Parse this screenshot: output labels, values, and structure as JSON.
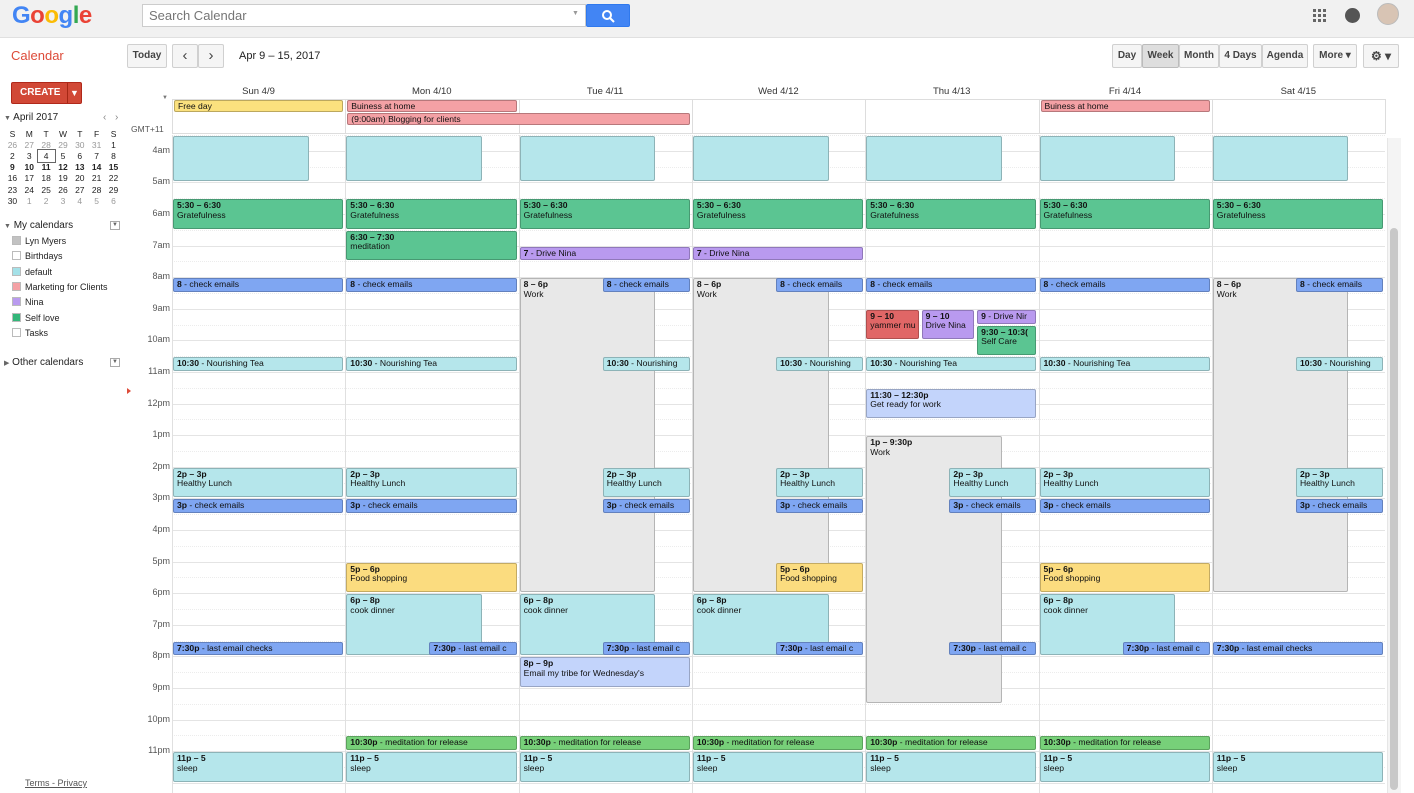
{
  "header": {
    "logo": "Google",
    "search_placeholder": "Search Calendar"
  },
  "toolbar": {
    "app_title": "Calendar",
    "today": "Today",
    "prev": "‹",
    "next": "›",
    "date_range": "Apr 9 – 15, 2017",
    "views": [
      "Day",
      "Week",
      "Month",
      "4 Days",
      "Agenda"
    ],
    "active_view": "Week",
    "more": "More ▾",
    "settings": "⚙ ▾"
  },
  "sidebar": {
    "create": "CREATE",
    "mini_month": "April 2017",
    "weekdays": [
      "S",
      "M",
      "T",
      "W",
      "T",
      "F",
      "S"
    ],
    "weeks": [
      [
        "26",
        "27",
        "28",
        "29",
        "30",
        "31",
        "1"
      ],
      [
        "2",
        "3",
        "4",
        "5",
        "6",
        "7",
        "8"
      ],
      [
        "9",
        "10",
        "11",
        "12",
        "13",
        "14",
        "15"
      ],
      [
        "16",
        "17",
        "18",
        "19",
        "20",
        "21",
        "22"
      ],
      [
        "23",
        "24",
        "25",
        "26",
        "27",
        "28",
        "29"
      ],
      [
        "30",
        "1",
        "2",
        "3",
        "4",
        "5",
        "6"
      ]
    ],
    "my_calendars": "My calendars",
    "calendars": [
      {
        "name": "Lyn Myers",
        "color": "#c2c2c2"
      },
      {
        "name": "Birthdays",
        "color": "#ffffff"
      },
      {
        "name": "default",
        "color": "#a4e1e8"
      },
      {
        "name": "Marketing for Clients",
        "color": "#f4a1a5"
      },
      {
        "name": "Nina",
        "color": "#b99aef"
      },
      {
        "name": "Self love",
        "color": "#33b679"
      },
      {
        "name": "Tasks",
        "color": "#ffffff"
      }
    ],
    "other_calendars": "Other calendars",
    "footer_terms": "Terms",
    "footer_sep": " - ",
    "footer_privacy": "Privacy"
  },
  "week": {
    "timezone": "GMT+11",
    "days": [
      "Sun 4/9",
      "Mon 4/10",
      "Tue 4/11",
      "Wed 4/12",
      "Thu 4/13",
      "Fri 4/14",
      "Sat 4/15"
    ],
    "hours": [
      "4am",
      "5am",
      "6am",
      "7am",
      "8am",
      "9am",
      "10am",
      "11am",
      "12pm",
      "1pm",
      "2pm",
      "3pm",
      "4pm",
      "5pm",
      "6pm",
      "7pm",
      "8pm",
      "9pm",
      "10pm",
      "11pm"
    ],
    "allday": [
      {
        "day": 0,
        "span": 1,
        "title": "Free day",
        "color": "#fbe17e"
      },
      {
        "day": 1,
        "span": 1,
        "title": "Buiness at home",
        "color": "#f4a1a5"
      },
      {
        "day": 1,
        "span": 2,
        "row": 1,
        "title": "(9:00am) Blogging for clients",
        "color": "#f4a1a5"
      },
      {
        "day": 5,
        "span": 1,
        "title": "Buiness at home",
        "color": "#f4a1a5"
      }
    ],
    "colors": {
      "default": "#b5e6eb",
      "selflove": "#5bc592",
      "emails": "#7fa6f2",
      "nina": "#b99aef",
      "work": "#e8e8e8",
      "food": "#fbdc7f",
      "lavender": "#c3d4fb",
      "meditation": "#77d079",
      "red": "#e06666"
    },
    "events": [
      {
        "day": 0,
        "start": 3.5,
        "end": 5.0,
        "c": "default",
        "t": "",
        "l": "",
        "w": 0.8
      },
      {
        "day": 1,
        "start": 3.5,
        "end": 5.0,
        "c": "default",
        "t": "",
        "l": "",
        "w": 0.8
      },
      {
        "day": 2,
        "start": 3.5,
        "end": 5.0,
        "c": "default",
        "t": "",
        "l": "",
        "w": 0.8
      },
      {
        "day": 3,
        "start": 3.5,
        "end": 5.0,
        "c": "default",
        "t": "",
        "l": "",
        "w": 0.8
      },
      {
        "day": 4,
        "start": 3.5,
        "end": 5.0,
        "c": "default",
        "t": "",
        "l": "",
        "w": 0.8
      },
      {
        "day": 5,
        "start": 3.5,
        "end": 5.0,
        "c": "default",
        "t": "",
        "l": "",
        "w": 0.8
      },
      {
        "day": 6,
        "start": 3.5,
        "end": 5.0,
        "c": "default",
        "t": "",
        "l": "",
        "w": 0.8
      },
      {
        "day": 0,
        "start": 5.5,
        "end": 6.5,
        "c": "selflove",
        "t": "5:30 – 6:30",
        "l": "Gratefulness"
      },
      {
        "day": 1,
        "start": 5.5,
        "end": 6.5,
        "c": "selflove",
        "t": "5:30 – 6:30",
        "l": "Gratefulness"
      },
      {
        "day": 2,
        "start": 5.5,
        "end": 6.5,
        "c": "selflove",
        "t": "5:30 – 6:30",
        "l": "Gratefulness"
      },
      {
        "day": 3,
        "start": 5.5,
        "end": 6.5,
        "c": "selflove",
        "t": "5:30 – 6:30",
        "l": "Gratefulness"
      },
      {
        "day": 4,
        "start": 5.5,
        "end": 6.5,
        "c": "selflove",
        "t": "5:30 – 6:30",
        "l": "Gratefulness"
      },
      {
        "day": 5,
        "start": 5.5,
        "end": 6.5,
        "c": "selflove",
        "t": "5:30 – 6:30",
        "l": "Gratefulness"
      },
      {
        "day": 6,
        "start": 5.5,
        "end": 6.5,
        "c": "selflove",
        "t": "5:30 – 6:30",
        "l": "Gratefulness"
      },
      {
        "day": 1,
        "start": 6.5,
        "end": 7.5,
        "c": "selflove",
        "t": "6:30 – 7:30",
        "l": "meditation"
      },
      {
        "day": 2,
        "start": 7,
        "end": 7.5,
        "c": "nina",
        "t": "7",
        "l": " - Drive Nina",
        "inline": true
      },
      {
        "day": 3,
        "start": 7,
        "end": 7.5,
        "c": "nina",
        "t": "7",
        "l": " - Drive Nina",
        "inline": true
      },
      {
        "day": 0,
        "start": 8,
        "end": 8.5,
        "c": "emails",
        "t": "8",
        "l": " - check emails",
        "inline": true
      },
      {
        "day": 1,
        "start": 8,
        "end": 8.5,
        "c": "emails",
        "t": "8",
        "l": " - check emails",
        "inline": true
      },
      {
        "day": 2,
        "start": 8,
        "end": 18,
        "c": "work",
        "t": "8 – 6p",
        "l": "Work",
        "w": 0.8
      },
      {
        "day": 2,
        "start": 8,
        "end": 8.5,
        "c": "emails",
        "t": "8",
        "l": " - check emails",
        "inline": true,
        "x": 0.48
      },
      {
        "day": 3,
        "start": 8,
        "end": 18,
        "c": "work",
        "t": "8 – 6p",
        "l": "Work",
        "w": 0.8
      },
      {
        "day": 3,
        "start": 8,
        "end": 8.5,
        "c": "emails",
        "t": "8",
        "l": " - check emails",
        "inline": true,
        "x": 0.48
      },
      {
        "day": 4,
        "start": 8,
        "end": 8.5,
        "c": "emails",
        "t": "8",
        "l": " - check emails",
        "inline": true
      },
      {
        "day": 5,
        "start": 8,
        "end": 8.5,
        "c": "emails",
        "t": "8",
        "l": " - check emails",
        "inline": true
      },
      {
        "day": 6,
        "start": 8,
        "end": 18,
        "c": "work",
        "t": "8 – 6p",
        "l": "Work",
        "w": 0.8
      },
      {
        "day": 6,
        "start": 8,
        "end": 8.5,
        "c": "emails",
        "t": "8",
        "l": " - check emails",
        "inline": true,
        "x": 0.48
      },
      {
        "day": 4,
        "start": 9,
        "end": 10,
        "c": "red",
        "t": "9 – 10",
        "l": "yammer mu",
        "w": 0.32
      },
      {
        "day": 4,
        "start": 9,
        "end": 10,
        "c": "nina",
        "t": "9 – 10",
        "l": "Drive Nina",
        "x": 0.32,
        "w": 0.32
      },
      {
        "day": 4,
        "start": 9,
        "end": 9.5,
        "c": "nina",
        "t": "9",
        "l": " - Drive Nir",
        "inline": true,
        "x": 0.64,
        "w": 0.36
      },
      {
        "day": 4,
        "start": 9.5,
        "end": 10.5,
        "c": "selflove",
        "t": "9:30 – 10:3(",
        "l": "Self Care",
        "x": 0.64,
        "w": 0.36
      },
      {
        "day": 0,
        "start": 10.5,
        "end": 11,
        "c": "default",
        "t": "10:30",
        "l": " - Nourishing Tea",
        "inline": true
      },
      {
        "day": 1,
        "start": 10.5,
        "end": 11,
        "c": "default",
        "t": "10:30",
        "l": " - Nourishing Tea",
        "inline": true
      },
      {
        "day": 2,
        "start": 10.5,
        "end": 11,
        "c": "default",
        "t": "10:30",
        "l": " - Nourishing",
        "inline": true,
        "x": 0.48
      },
      {
        "day": 3,
        "start": 10.5,
        "end": 11,
        "c": "default",
        "t": "10:30",
        "l": " - Nourishing",
        "inline": true,
        "x": 0.48
      },
      {
        "day": 4,
        "start": 10.5,
        "end": 11,
        "c": "default",
        "t": "10:30",
        "l": " - Nourishing Tea",
        "inline": true
      },
      {
        "day": 5,
        "start": 10.5,
        "end": 11,
        "c": "default",
        "t": "10:30",
        "l": " - Nourishing Tea",
        "inline": true
      },
      {
        "day": 6,
        "start": 10.5,
        "end": 11,
        "c": "default",
        "t": "10:30",
        "l": " - Nourishing",
        "inline": true,
        "x": 0.48
      },
      {
        "day": 4,
        "start": 11.5,
        "end": 12.5,
        "c": "lavender",
        "t": "11:30 – 12:30p",
        "l": "Get ready for work"
      },
      {
        "day": 4,
        "start": 13,
        "end": 21.5,
        "c": "work",
        "t": "1p – 9:30p",
        "l": "Work",
        "w": 0.8
      },
      {
        "day": 0,
        "start": 14,
        "end": 15,
        "c": "default",
        "t": "2p – 3p",
        "l": "Healthy Lunch"
      },
      {
        "day": 1,
        "start": 14,
        "end": 15,
        "c": "default",
        "t": "2p – 3p",
        "l": "Healthy Lunch"
      },
      {
        "day": 2,
        "start": 14,
        "end": 15,
        "c": "default",
        "t": "2p – 3p",
        "l": "Healthy Lunch",
        "x": 0.48
      },
      {
        "day": 3,
        "start": 14,
        "end": 15,
        "c": "default",
        "t": "2p – 3p",
        "l": "Healthy Lunch",
        "x": 0.48
      },
      {
        "day": 4,
        "start": 14,
        "end": 15,
        "c": "default",
        "t": "2p – 3p",
        "l": "Healthy Lunch",
        "x": 0.48
      },
      {
        "day": 5,
        "start": 14,
        "end": 15,
        "c": "default",
        "t": "2p – 3p",
        "l": "Healthy Lunch"
      },
      {
        "day": 6,
        "start": 14,
        "end": 15,
        "c": "default",
        "t": "2p – 3p",
        "l": "Healthy Lunch",
        "x": 0.48
      },
      {
        "day": 0,
        "start": 15,
        "end": 15.5,
        "c": "emails",
        "t": "3p",
        "l": " - check emails",
        "inline": true
      },
      {
        "day": 1,
        "start": 15,
        "end": 15.5,
        "c": "emails",
        "t": "3p",
        "l": " - check emails",
        "inline": true
      },
      {
        "day": 2,
        "start": 15,
        "end": 15.5,
        "c": "emails",
        "t": "3p",
        "l": " - check emails",
        "inline": true,
        "x": 0.48
      },
      {
        "day": 3,
        "start": 15,
        "end": 15.5,
        "c": "emails",
        "t": "3p",
        "l": " - check emails",
        "inline": true,
        "x": 0.48
      },
      {
        "day": 4,
        "start": 15,
        "end": 15.5,
        "c": "emails",
        "t": "3p",
        "l": " - check emails",
        "inline": true,
        "x": 0.48
      },
      {
        "day": 5,
        "start": 15,
        "end": 15.5,
        "c": "emails",
        "t": "3p",
        "l": " - check emails",
        "inline": true
      },
      {
        "day": 6,
        "start": 15,
        "end": 15.5,
        "c": "emails",
        "t": "3p",
        "l": " - check emails",
        "inline": true,
        "x": 0.48
      },
      {
        "day": 1,
        "start": 17,
        "end": 18,
        "c": "food",
        "t": "5p – 6p",
        "l": "Food shopping"
      },
      {
        "day": 3,
        "start": 17,
        "end": 18,
        "c": "food",
        "t": "5p – 6p",
        "l": "Food shopping",
        "x": 0.48
      },
      {
        "day": 5,
        "start": 17,
        "end": 18,
        "c": "food",
        "t": "5p – 6p",
        "l": "Food shopping"
      },
      {
        "day": 1,
        "start": 18,
        "end": 20,
        "c": "default",
        "t": "6p – 8p",
        "l": "cook dinner",
        "w": 0.8
      },
      {
        "day": 2,
        "start": 18,
        "end": 20,
        "c": "default",
        "t": "6p – 8p",
        "l": "cook dinner",
        "w": 0.8
      },
      {
        "day": 3,
        "start": 18,
        "end": 20,
        "c": "default",
        "t": "6p – 8p",
        "l": "cook dinner",
        "w": 0.8
      },
      {
        "day": 5,
        "start": 18,
        "end": 20,
        "c": "default",
        "t": "6p – 8p",
        "l": "cook dinner",
        "w": 0.8
      },
      {
        "day": 0,
        "start": 19.5,
        "end": 20,
        "c": "emails",
        "t": "7:30p",
        "l": " - last email checks",
        "inline": true
      },
      {
        "day": 1,
        "start": 19.5,
        "end": 20,
        "c": "emails",
        "t": "7:30p",
        "l": " - last email c",
        "inline": true,
        "x": 0.48
      },
      {
        "day": 2,
        "start": 19.5,
        "end": 20,
        "c": "emails",
        "t": "7:30p",
        "l": " - last email c",
        "inline": true,
        "x": 0.48
      },
      {
        "day": 3,
        "start": 19.5,
        "end": 20,
        "c": "emails",
        "t": "7:30p",
        "l": " - last email c",
        "inline": true,
        "x": 0.48
      },
      {
        "day": 4,
        "start": 19.5,
        "end": 20,
        "c": "emails",
        "t": "7:30p",
        "l": " - last email c",
        "inline": true,
        "x": 0.48
      },
      {
        "day": 5,
        "start": 19.5,
        "end": 20,
        "c": "emails",
        "t": "7:30p",
        "l": " - last email c",
        "inline": true,
        "x": 0.48
      },
      {
        "day": 6,
        "start": 19.5,
        "end": 20,
        "c": "emails",
        "t": "7:30p",
        "l": " - last email checks",
        "inline": true
      },
      {
        "day": 2,
        "start": 20,
        "end": 21,
        "c": "lavender",
        "t": "8p – 9p",
        "l": "Email my tribe for Wednesday's"
      },
      {
        "day": 1,
        "start": 22.5,
        "end": 23,
        "c": "meditation",
        "t": "10:30p",
        "l": " - meditation for release",
        "inline": true
      },
      {
        "day": 2,
        "start": 22.5,
        "end": 23,
        "c": "meditation",
        "t": "10:30p",
        "l": " - meditation for release",
        "inline": true
      },
      {
        "day": 3,
        "start": 22.5,
        "end": 23,
        "c": "meditation",
        "t": "10:30p",
        "l": " - meditation for release",
        "inline": true
      },
      {
        "day": 4,
        "start": 22.5,
        "end": 23,
        "c": "meditation",
        "t": "10:30p",
        "l": " - meditation for release",
        "inline": true
      },
      {
        "day": 5,
        "start": 22.5,
        "end": 23,
        "c": "meditation",
        "t": "10:30p",
        "l": " - meditation for release",
        "inline": true
      },
      {
        "day": 0,
        "start": 23,
        "end": 24,
        "c": "default",
        "t": "11p – 5",
        "l": "sleep"
      },
      {
        "day": 1,
        "start": 23,
        "end": 24,
        "c": "default",
        "t": "11p – 5",
        "l": "sleep"
      },
      {
        "day": 2,
        "start": 23,
        "end": 24,
        "c": "default",
        "t": "11p – 5",
        "l": "sleep"
      },
      {
        "day": 3,
        "start": 23,
        "end": 24,
        "c": "default",
        "t": "11p – 5",
        "l": "sleep"
      },
      {
        "day": 4,
        "start": 23,
        "end": 24,
        "c": "default",
        "t": "11p – 5",
        "l": "sleep"
      },
      {
        "day": 5,
        "start": 23,
        "end": 24,
        "c": "default",
        "t": "11p – 5",
        "l": "sleep"
      },
      {
        "day": 6,
        "start": 23,
        "end": 24,
        "c": "default",
        "t": "11p – 5",
        "l": "sleep"
      }
    ]
  }
}
